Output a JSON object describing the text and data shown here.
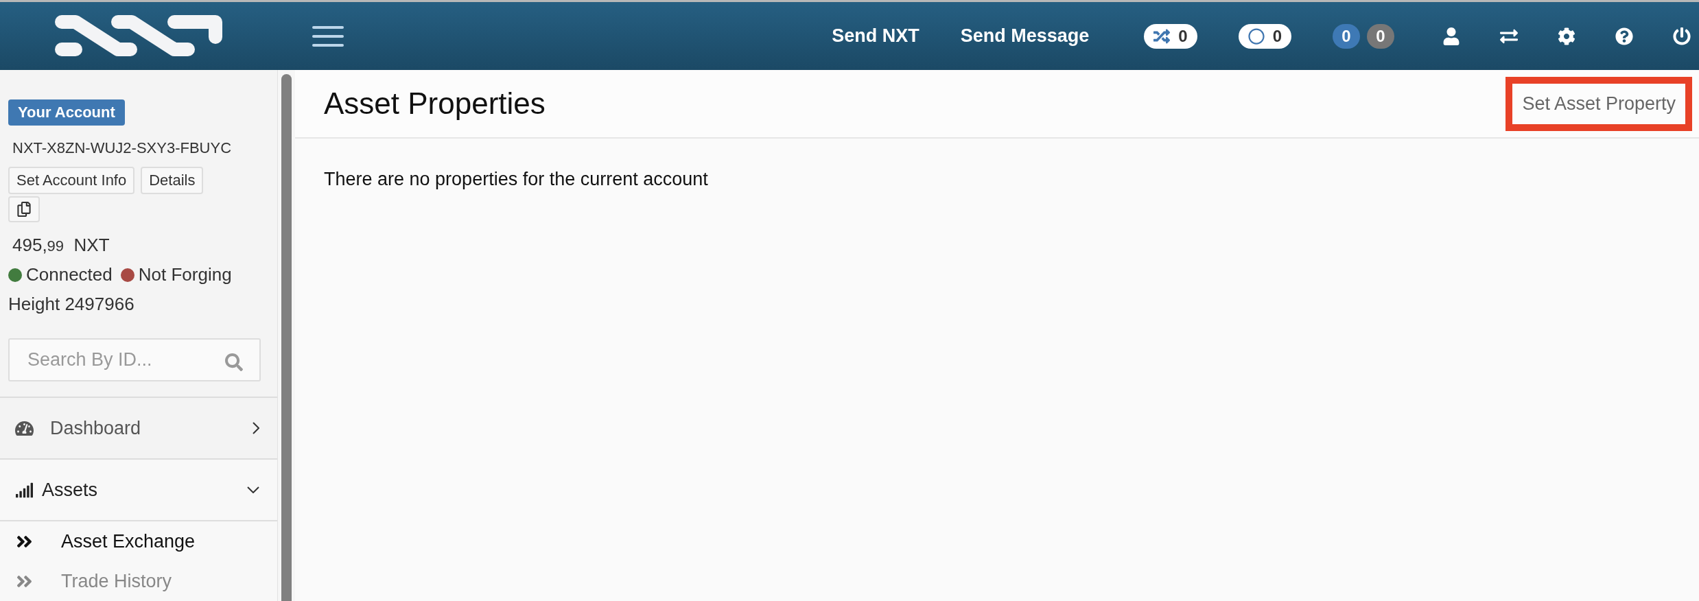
{
  "header": {
    "nav_links": [
      "Send NXT",
      "Send Message"
    ],
    "badges": [
      {
        "kind": "shuffle",
        "count": "0"
      },
      {
        "kind": "circle",
        "count": "0"
      },
      {
        "kind": "pair",
        "counts": [
          "0",
          "0"
        ]
      }
    ]
  },
  "sidebar": {
    "account_label": "Your Account",
    "account_id": "NXT-X8ZN-WUJ2-SXY3-FBUYC",
    "account_buttons": [
      "Set Account Info",
      "Details"
    ],
    "balance": {
      "amount": "495,",
      "decimals": "99",
      "unit": "NXT"
    },
    "status": [
      {
        "label": "Connected",
        "color": "#427c3f"
      },
      {
        "label": "Not Forging",
        "color": "#a84a44"
      }
    ],
    "height": "Height 2497966",
    "search": {
      "placeholder": "Search By ID..."
    },
    "menu": [
      {
        "kind": "gauge",
        "label": "Dashboard",
        "expanded": false
      },
      {
        "kind": "bars",
        "label": "Assets",
        "expanded": true,
        "children": [
          {
            "label": "Asset Exchange",
            "selected": true
          },
          {
            "label": "Trade History",
            "selected": false
          }
        ]
      }
    ]
  },
  "page": {
    "title": "Asset Properties",
    "action": {
      "label": "Set Asset Property",
      "highlighted": true
    },
    "empty_message": "There are no properties for the current account"
  }
}
